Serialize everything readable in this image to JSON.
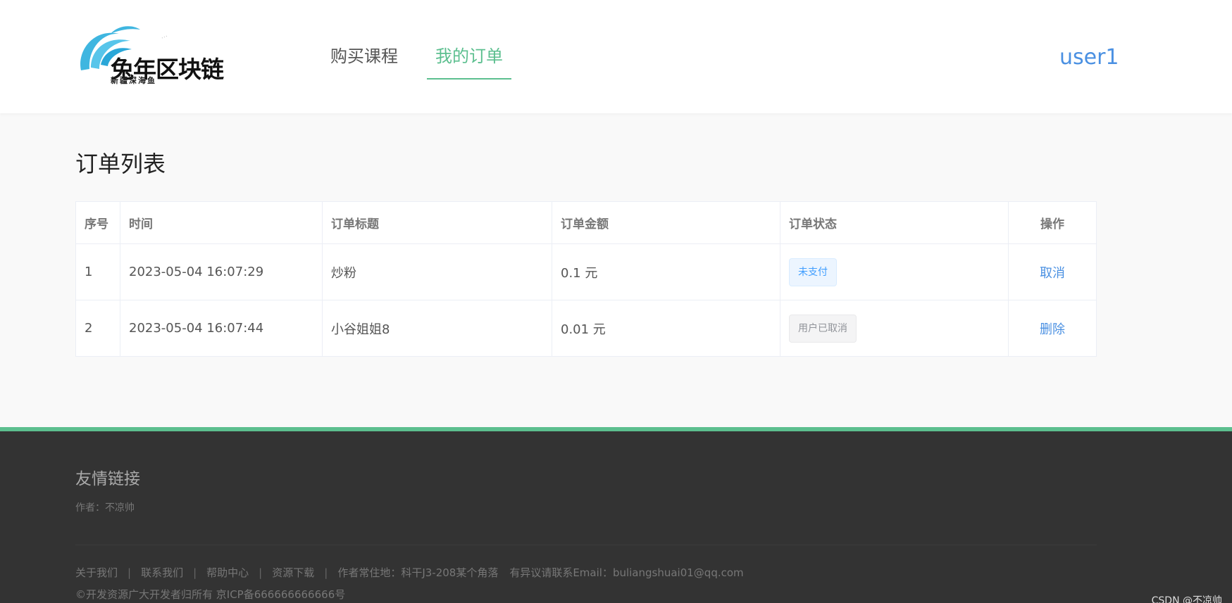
{
  "header": {
    "logo_text": "兔年区块链",
    "logo_subtext": "新疆深海鱼",
    "nav": [
      {
        "label": "购买课程"
      },
      {
        "label": "我的订单"
      }
    ],
    "user": "user1"
  },
  "main": {
    "title": "订单列表",
    "columns": [
      "序号",
      "时间",
      "订单标题",
      "订单金额",
      "订单状态",
      "操作"
    ],
    "rows": [
      {
        "index": "1",
        "time": "2023-05-04 16:07:29",
        "title": "炒粉",
        "amount": "0.1 元",
        "status": "未支付",
        "action": "取消"
      },
      {
        "index": "2",
        "time": "2023-05-04 16:07:44",
        "title": "小谷姐姐8",
        "amount": "0.01 元",
        "status": "用户已取消",
        "action": "删除"
      }
    ]
  },
  "footer": {
    "title": "友情链接",
    "author": "作者：不凉帅",
    "links": [
      "关于我们",
      "联系我们",
      "帮助中心",
      "资源下载"
    ],
    "address": "作者常住地：科干J3-208某个角落",
    "email": "有异议请联系Email：buliangshuai01@qq.com",
    "copyright": "©开发资源广大开发者归所有 京ICP备666666666666号",
    "watermark": "CSDN @不凉帅"
  },
  "colors": {
    "accent": "#5cbf8f",
    "link": "#4a90e2",
    "footer_bg": "#333333"
  }
}
